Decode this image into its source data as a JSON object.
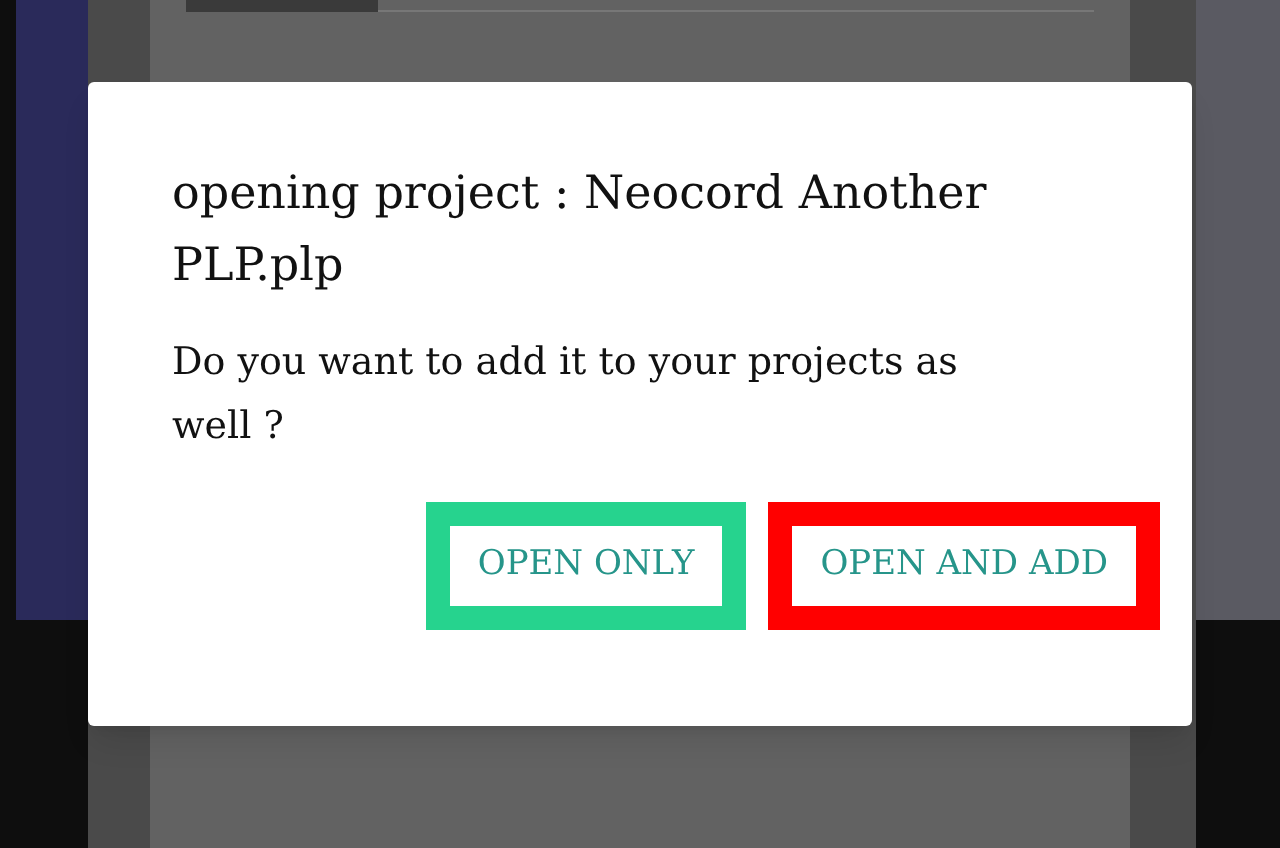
{
  "dialog": {
    "title": "opening project : Neocord Another PLP.plp",
    "message": "Do you want to add it to your projects as well ?",
    "buttons": [
      {
        "label": "OPEN ONLY",
        "color": "#26d38e"
      },
      {
        "label": "OPEN AND ADD",
        "color": "#ff0000"
      }
    ]
  }
}
